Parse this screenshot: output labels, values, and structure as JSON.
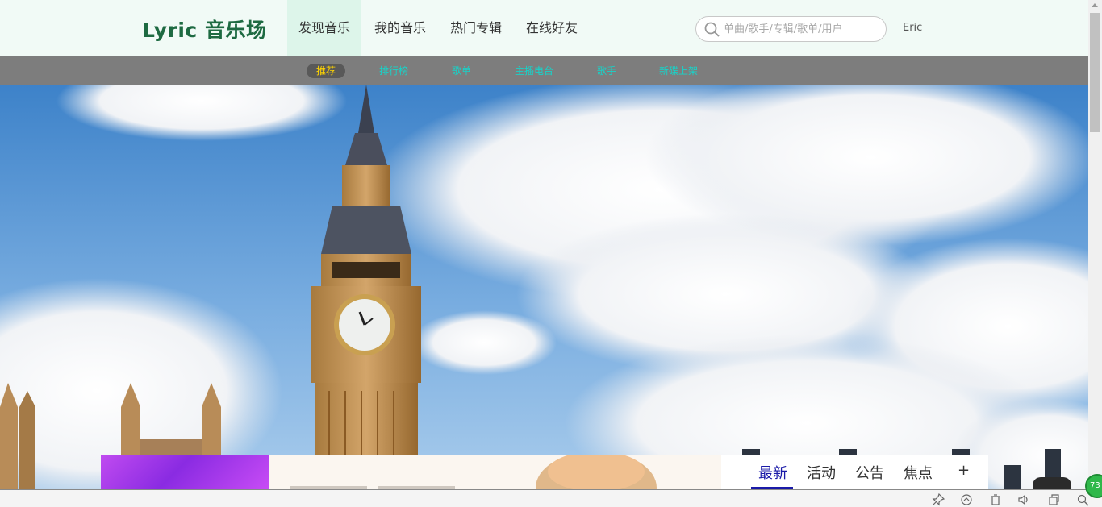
{
  "header": {
    "logo": "Lyric 音乐场",
    "nav": [
      "发现音乐",
      "我的音乐",
      "热门专辑",
      "在线好友"
    ],
    "search_placeholder": "单曲/歌手/专辑/歌单/用户",
    "user_name": "Eric"
  },
  "subnav": {
    "items": [
      "推荐",
      "排行榜",
      "歌单",
      "主播电台",
      "歌手",
      "新碟上架"
    ]
  },
  "hero": {
    "icon": "big-ben-photo"
  },
  "panel": {
    "tabs": [
      "最新",
      "活动",
      "公告",
      "焦点"
    ],
    "more_label": "+"
  },
  "statusbar": {
    "badge": "73",
    "icons": [
      "pin-icon",
      "refresh-icon",
      "trash-icon",
      "volume-icon",
      "window-icon",
      "zoom-icon"
    ]
  },
  "colors": {
    "header_bg": "#f1faf6",
    "logo": "#1e6a42",
    "subnav_bg": "#7d7d7d",
    "subnav_link": "#19d2c8",
    "subnav_active": "#ffd400",
    "tab_active": "#1a1aa8"
  }
}
